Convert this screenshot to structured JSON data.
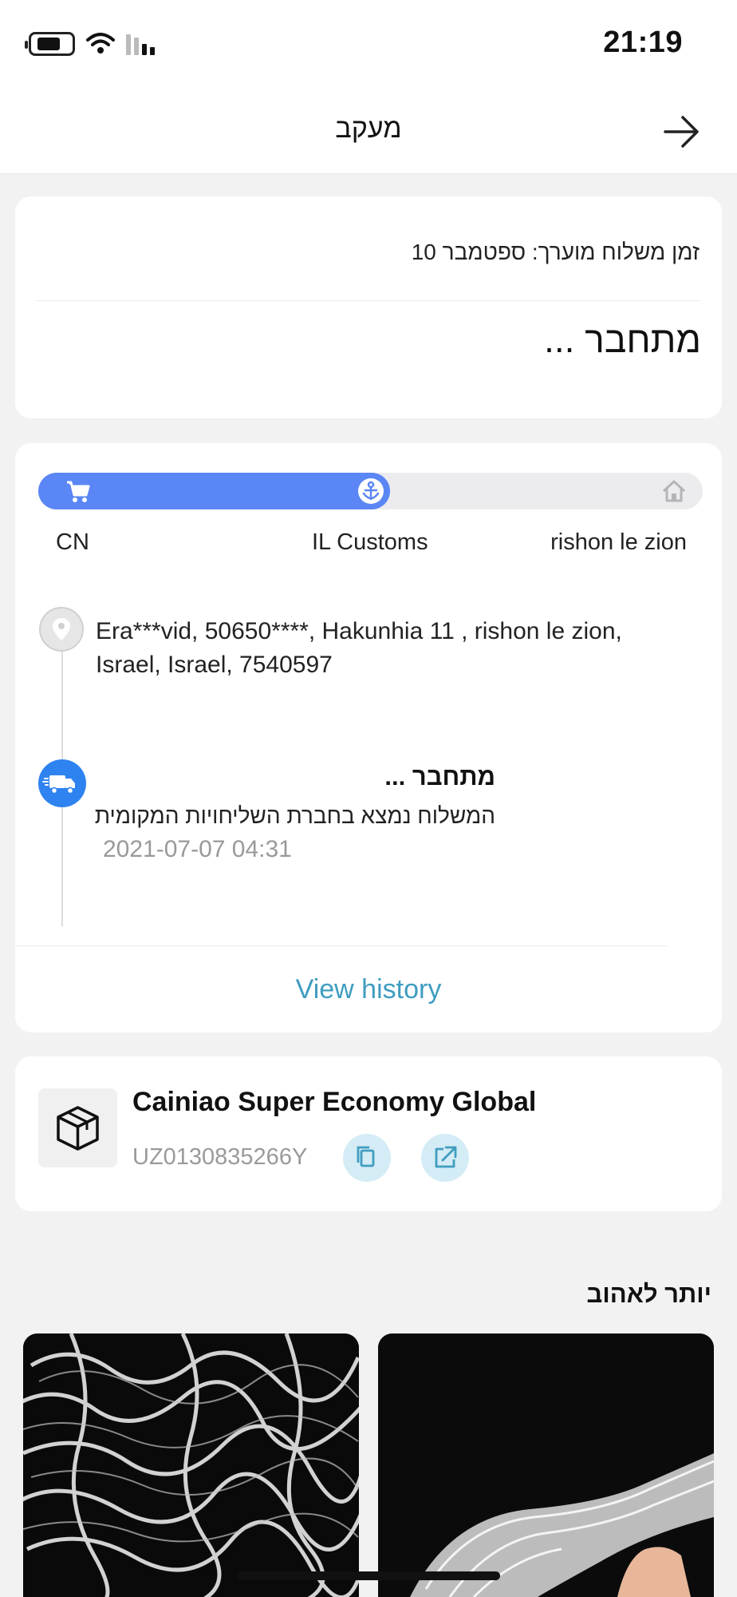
{
  "status_bar": {
    "time": "21:19"
  },
  "nav": {
    "title": "מעקב"
  },
  "summary": {
    "eta": "זמן משלוח מוערך: ספטמבר 10",
    "status": "מתחבר ..."
  },
  "progress": {
    "fill_fraction": 0.53,
    "stages": [
      "CN",
      "IL Customs",
      "rishon le zion"
    ]
  },
  "timeline": {
    "address": "Era***vid,  50650****,  Hakunhia 11 ,  rishon le zion,  Israel,  Israel,  7540597",
    "event_title": "מתחבר ...",
    "event_desc": "המשלוח נמצא בחברת השליחויות המקומית",
    "event_time": "2021-07-07 04:31",
    "view_history": "View history"
  },
  "carrier": {
    "name": "Cainiao Super Economy Global",
    "tracking_number": "UZ0130835266Y"
  },
  "recommendations": {
    "title": "יותר לאהוב"
  },
  "colors": {
    "accent": "#5b86f5",
    "link": "#3f9dc0",
    "truck": "#2f83f0"
  }
}
